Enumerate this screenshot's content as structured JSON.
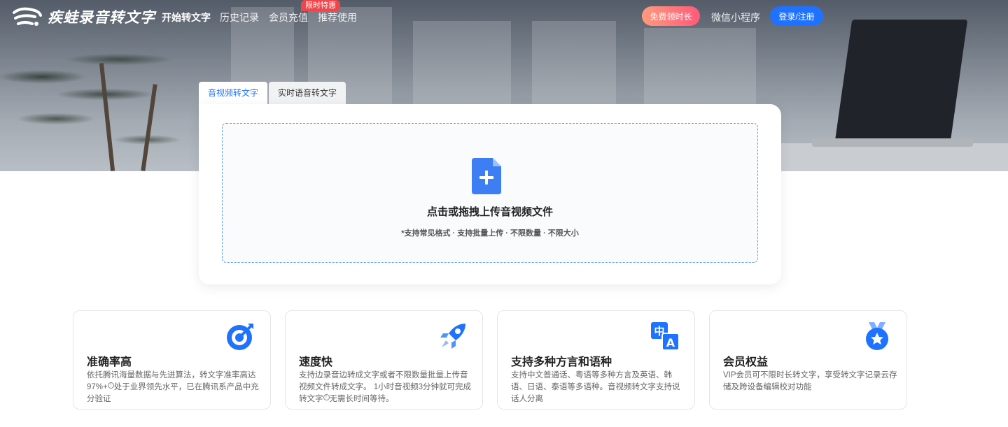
{
  "header": {
    "logo_text": "疾蛙录音转文字",
    "nav": [
      {
        "label": "开始转文字",
        "active": true
      },
      {
        "label": "历史记录",
        "active": false
      },
      {
        "label": "会员充值",
        "active": false
      },
      {
        "label": "推荐使用",
        "active": false
      }
    ],
    "hot_badge": "限时特惠",
    "free_button": "免费领时长",
    "mini_program": "微信小程序",
    "login_button": "登录/注册"
  },
  "upload": {
    "tabs": [
      {
        "label": "音视频转文字",
        "active": true
      },
      {
        "label": "实时语音转文字",
        "active": false
      }
    ],
    "title": "点击或拖拽上传音视频文件",
    "subtitle": "*支持常见格式 · 支持批量上传 · 不限数量 · 不限大小"
  },
  "features": [
    {
      "title": "准确率高",
      "icon": "target-icon",
      "desc_a": "依托腾讯海量数据与先进算法，转文字准率高达97%+",
      "desc_b": "处于业界领先水平，已在腾讯系产品中充分验证"
    },
    {
      "title": "速度快",
      "icon": "rocket-icon",
      "desc_a": "支持边录音边转成文字或者不限数量批量上传音视频文件转成文字。 1小时音视频3分钟就可完成转文字",
      "desc_b": "无需长时间等待。"
    },
    {
      "title": "支持多种方言和语种",
      "icon": "translate-icon",
      "desc_a": "支持中文普通话、粤语等多种方言及英语、韩语、日语、泰语等多语种。音视频转文字支持说话人分离",
      "desc_b": ""
    },
    {
      "title": "会员权益",
      "icon": "vip-medal-icon",
      "desc_a": "VIP会员可不限时长转文字，享受转文字记录云存储及跨设备编辑校对功能",
      "desc_b": ""
    }
  ],
  "colors": {
    "accent": "#1e72ff",
    "hot_badge": "#f0454a",
    "free_gradient_start": "#ff9a7d",
    "free_gradient_end": "#ff5a7a"
  }
}
